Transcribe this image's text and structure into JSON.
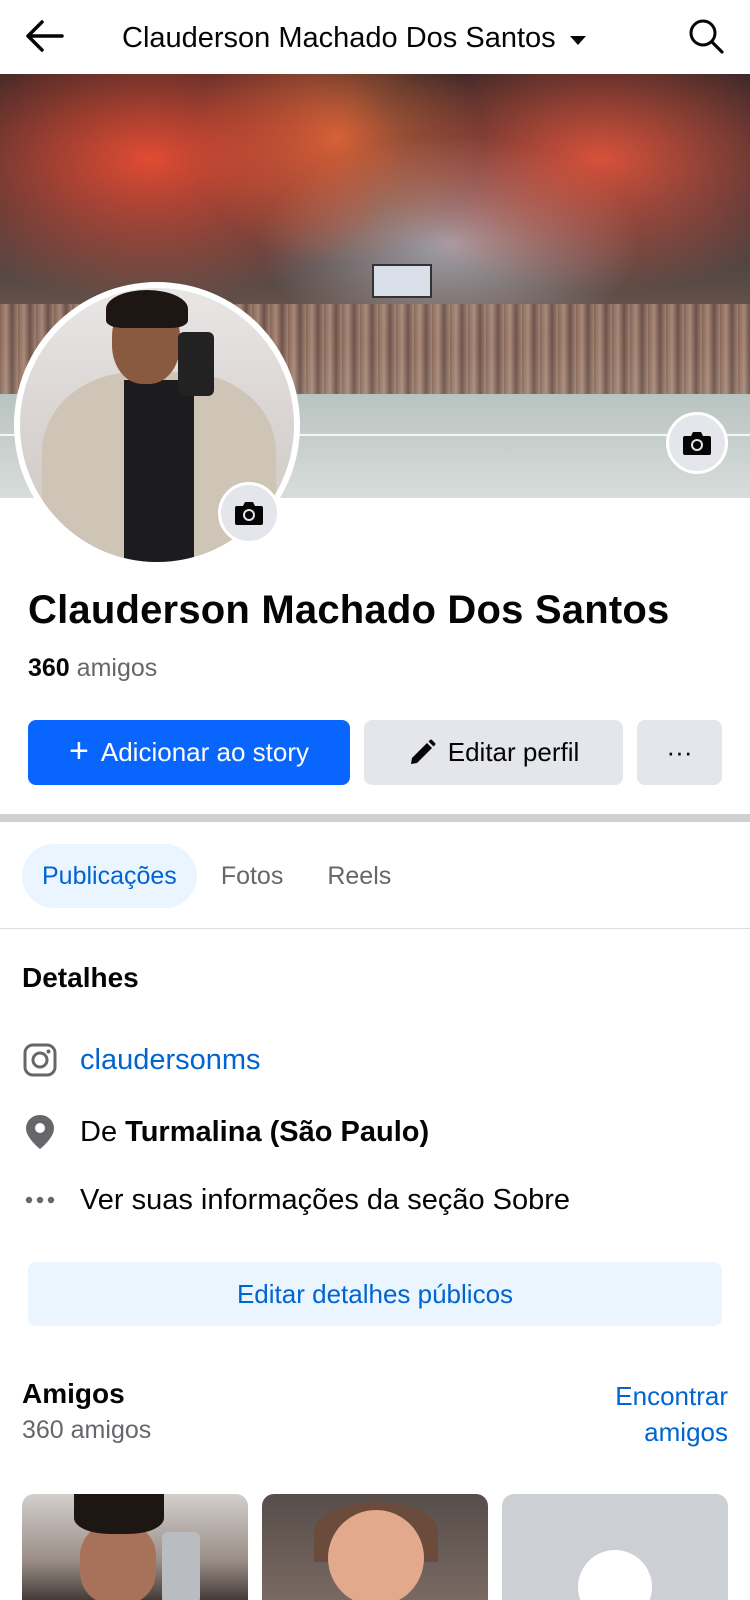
{
  "header": {
    "title": "Clauderson Machado Dos Santos",
    "back_icon": "arrow-left-icon",
    "search_icon": "search-icon",
    "dropdown_icon": "caret-down-icon"
  },
  "profile": {
    "name": "Clauderson Machado Dos Santos",
    "friends_count": "360",
    "friends_word": "amigos"
  },
  "actions": {
    "add_story": "Adicionar ao story",
    "edit_profile": "Editar perfil",
    "more": "···"
  },
  "tabs": [
    {
      "label": "Publicações",
      "active": true
    },
    {
      "label": "Fotos",
      "active": false
    },
    {
      "label": "Reels",
      "active": false
    }
  ],
  "details": {
    "title": "Detalhes",
    "instagram": "claudersonms",
    "hometown_prefix": "De",
    "hometown": "Turmalina (São Paulo)",
    "about_link": "Ver suas informações da seção Sobre",
    "edit_public": "Editar detalhes públicos"
  },
  "friends_section": {
    "title": "Amigos",
    "subtitle": "360 amigos",
    "find_friends": "Encontrar amigos"
  },
  "colors": {
    "primary_blue": "#0866ff",
    "link_blue": "#0064d1",
    "light_blue_bg": "#ebf5ff",
    "gray_button": "#e4e6eb",
    "secondary_text": "#65676b"
  }
}
